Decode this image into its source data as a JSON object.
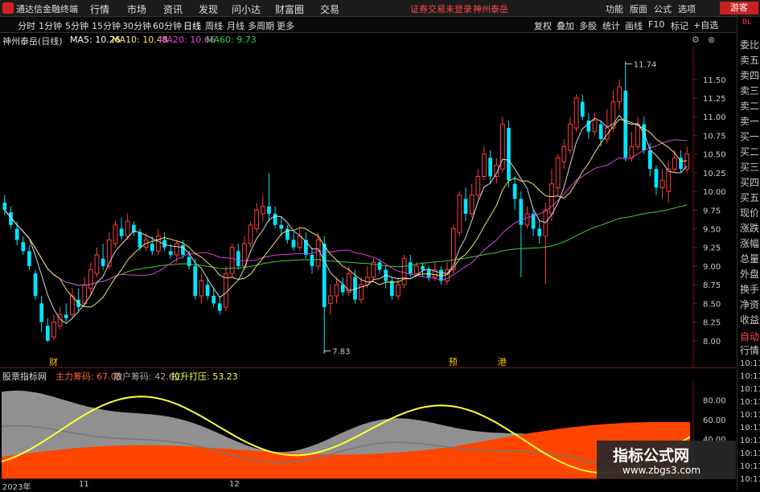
{
  "app": {
    "title": "通达信金融终端",
    "menu": [
      "行情",
      "市场",
      "资讯",
      "发现",
      "问小达",
      "财富圈",
      "交易"
    ],
    "status_text": "证券交易未登录",
    "stock_link": "神州泰岳",
    "right_menu": [
      "功能",
      "版面",
      "公式",
      "选项"
    ],
    "guest": "游客"
  },
  "toolbar": {
    "timeframes": [
      "分时",
      "1分钟",
      "5分钟",
      "15分钟",
      "30分钟",
      "60分钟",
      "日线",
      "周线",
      "月线",
      "多周期",
      "更多"
    ],
    "active": "日线",
    "right_tools": [
      "复权",
      "叠加",
      "多股",
      "统计",
      "画线",
      "F10",
      "标记"
    ],
    "auto_select": "+自选"
  },
  "stock_header": {
    "name": "神州泰岳(日线)",
    "ma5": "MA5: 10.26",
    "ma10": "MA10: 10.48",
    "ma20": "MA20: 10.66",
    "ma60": "MA60: 9.73",
    "colors": {
      "ma5": "#ffffff",
      "ma10": "#f5e56b",
      "ma20": "#e040e0",
      "ma60": "#40d040"
    }
  },
  "right_panel": {
    "top_tag": "BL",
    "labels": [
      "委比",
      "卖五",
      "卖四",
      "卖三",
      "卖二",
      "卖一",
      "买一",
      "买二",
      "买三",
      "买四",
      "买五",
      "现价",
      "涨跌",
      "涨幅",
      "总量",
      "外盘",
      "换手",
      "净资",
      "收益",
      "自动",
      "行情"
    ],
    "times": [
      "10:11",
      "10:11",
      "10:11",
      "10:11",
      "10:11",
      "10:11",
      "10:11",
      "10:11",
      "10:11",
      "10:11"
    ]
  },
  "indicator_header": {
    "name": "股票指标网",
    "main": "主力筹码: 67.08",
    "retail": "散户筹码: 42.60",
    "pull": "拉升打压: 53.23"
  },
  "x_axis_labels": [
    "2023年",
    "11",
    "12"
  ],
  "watermark": {
    "line1": "指标公式网",
    "line2": "www.zbgs3.com"
  },
  "chart_data": {
    "type": "candlestick",
    "y_ticks": [
      "11.50",
      "11.25",
      "11.00",
      "10.75",
      "10.50",
      "10.25",
      "10.00",
      "9.75",
      "9.50",
      "9.25",
      "9.00",
      "8.75",
      "8.50",
      "8.25",
      "8.00"
    ],
    "ylim": [
      7.75,
      11.95
    ],
    "high_label": "11.74",
    "low_label": "7.83",
    "event_markers": [
      "财",
      "预",
      "港"
    ],
    "up_color": "#ff4040",
    "down_color": "#00e5ff",
    "candles": [
      [
        9.85,
        9.75,
        9.95,
        9.68
      ],
      [
        9.72,
        9.55,
        9.8,
        9.5
      ],
      [
        9.5,
        9.35,
        9.6,
        9.28
      ],
      [
        9.32,
        9.2,
        9.4,
        9.15
      ],
      [
        9.2,
        9.0,
        9.28,
        8.95
      ],
      [
        8.9,
        8.6,
        8.95,
        8.55
      ],
      [
        8.5,
        8.25,
        8.6,
        8.12
      ],
      [
        8.2,
        8.0,
        8.3,
        7.98
      ],
      [
        8.05,
        8.25,
        8.35,
        8.0
      ],
      [
        8.2,
        8.35,
        8.45,
        8.15
      ],
      [
        8.35,
        8.3,
        8.5,
        8.25
      ],
      [
        8.35,
        8.6,
        8.7,
        8.3
      ],
      [
        8.55,
        8.45,
        8.7,
        8.4
      ],
      [
        8.5,
        8.75,
        8.85,
        8.45
      ],
      [
        8.7,
        8.95,
        9.05,
        8.6
      ],
      [
        8.9,
        9.15,
        9.25,
        8.85
      ],
      [
        9.1,
        9.0,
        9.3,
        8.95
      ],
      [
        9.0,
        9.35,
        9.45,
        8.95
      ],
      [
        9.3,
        9.55,
        9.6,
        9.25
      ],
      [
        9.5,
        9.4,
        9.65,
        9.35
      ],
      [
        9.4,
        9.6,
        9.7,
        9.35
      ],
      [
        9.55,
        9.45,
        9.6,
        9.4
      ],
      [
        9.45,
        9.25,
        9.5,
        9.2
      ],
      [
        9.25,
        9.35,
        9.45,
        9.2
      ],
      [
        9.3,
        9.2,
        9.4,
        9.15
      ],
      [
        9.2,
        9.4,
        9.5,
        9.15
      ],
      [
        9.35,
        9.25,
        9.45,
        9.2
      ],
      [
        9.2,
        9.15,
        9.3,
        9.1
      ],
      [
        9.15,
        9.3,
        9.35,
        9.05
      ],
      [
        9.28,
        9.15,
        9.35,
        9.1
      ],
      [
        9.12,
        9.0,
        9.2,
        8.95
      ],
      [
        9.0,
        8.6,
        9.1,
        8.55
      ],
      [
        8.6,
        8.8,
        8.9,
        8.5
      ],
      [
        8.75,
        8.6,
        8.85,
        8.55
      ],
      [
        8.6,
        8.5,
        8.7,
        8.45
      ],
      [
        8.5,
        8.4,
        8.6,
        8.35
      ],
      [
        8.45,
        8.9,
        9.0,
        8.4
      ],
      [
        8.9,
        9.25,
        9.3,
        8.85
      ],
      [
        9.2,
        9.0,
        9.3,
        8.95
      ],
      [
        9.0,
        9.3,
        9.4,
        8.95
      ],
      [
        9.3,
        9.55,
        9.6,
        9.25
      ],
      [
        9.5,
        9.75,
        9.85,
        9.45
      ],
      [
        9.7,
        9.8,
        9.95,
        9.6
      ],
      [
        9.8,
        9.7,
        10.25,
        9.6
      ],
      [
        9.7,
        9.55,
        9.8,
        9.5
      ],
      [
        9.55,
        9.5,
        9.65,
        9.4
      ],
      [
        9.5,
        9.35,
        9.55,
        9.3
      ],
      [
        9.35,
        9.25,
        9.45,
        9.2
      ],
      [
        9.25,
        9.4,
        9.5,
        9.2
      ],
      [
        9.35,
        9.15,
        9.45,
        9.1
      ],
      [
        9.15,
        9.0,
        9.25,
        8.9
      ],
      [
        9.0,
        9.35,
        9.45,
        8.95
      ],
      [
        9.3,
        8.45,
        9.4,
        7.83
      ],
      [
        8.5,
        8.6,
        8.75,
        8.35
      ],
      [
        8.6,
        8.75,
        8.85,
        8.5
      ],
      [
        8.75,
        8.65,
        8.85,
        8.6
      ],
      [
        8.65,
        8.9,
        9.0,
        8.6
      ],
      [
        8.85,
        8.55,
        8.95,
        8.5
      ],
      [
        8.55,
        8.75,
        8.85,
        8.5
      ],
      [
        8.75,
        8.85,
        9.0,
        8.7
      ],
      [
        8.85,
        9.05,
        9.1,
        8.8
      ],
      [
        9.05,
        8.95,
        9.1,
        8.9
      ],
      [
        8.95,
        8.8,
        9.0,
        8.7
      ],
      [
        8.8,
        8.6,
        8.85,
        8.55
      ],
      [
        8.6,
        8.75,
        8.85,
        8.55
      ],
      [
        8.75,
        9.1,
        9.15,
        8.7
      ],
      [
        9.05,
        8.9,
        9.15,
        8.85
      ],
      [
        8.9,
        9.0,
        9.05,
        8.85
      ],
      [
        9.0,
        8.95,
        9.05,
        8.85
      ],
      [
        8.95,
        8.85,
        9.0,
        8.8
      ],
      [
        8.85,
        8.95,
        9.05,
        8.8
      ],
      [
        8.95,
        8.8,
        9.0,
        8.75
      ],
      [
        8.8,
        8.95,
        9.05,
        8.75
      ],
      [
        8.95,
        9.5,
        9.55,
        8.9
      ],
      [
        9.45,
        9.95,
        10.0,
        9.4
      ],
      [
        9.9,
        9.7,
        10.05,
        9.6
      ],
      [
        9.7,
        9.95,
        10.1,
        9.65
      ],
      [
        9.95,
        10.2,
        10.3,
        9.9
      ],
      [
        10.2,
        10.5,
        10.6,
        10.15
      ],
      [
        10.45,
        10.2,
        10.55,
        10.1
      ],
      [
        10.2,
        10.35,
        10.45,
        10.1
      ],
      [
        10.3,
        10.9,
        11.0,
        10.25
      ],
      [
        10.85,
        10.15,
        10.95,
        10.05
      ],
      [
        10.1,
        9.9,
        10.2,
        9.75
      ],
      [
        9.9,
        9.55,
        10.0,
        8.85
      ],
      [
        9.55,
        9.7,
        9.8,
        9.5
      ],
      [
        9.7,
        9.5,
        9.75,
        9.4
      ],
      [
        9.5,
        9.4,
        9.6,
        9.3
      ],
      [
        9.4,
        9.75,
        9.85,
        8.75
      ],
      [
        9.7,
        10.1,
        10.3,
        9.6
      ],
      [
        10.05,
        10.45,
        10.5,
        9.95
      ],
      [
        10.4,
        10.6,
        10.7,
        10.3
      ],
      [
        10.55,
        10.9,
        11.0,
        10.5
      ],
      [
        10.85,
        11.25,
        11.3,
        10.8
      ],
      [
        11.2,
        11.0,
        11.3,
        10.95
      ],
      [
        10.95,
        10.8,
        11.05,
        10.7
      ],
      [
        10.8,
        10.95,
        11.05,
        10.75
      ],
      [
        10.9,
        10.7,
        10.95,
        10.6
      ],
      [
        10.7,
        10.85,
        11.1,
        10.65
      ],
      [
        10.85,
        11.2,
        11.35,
        10.8
      ],
      [
        11.2,
        11.4,
        11.5,
        11.1
      ],
      [
        11.35,
        10.45,
        11.74,
        10.4
      ],
      [
        10.45,
        10.6,
        10.8,
        10.4
      ],
      [
        10.6,
        10.9,
        11.0,
        10.55
      ],
      [
        10.9,
        10.55,
        11.0,
        10.5
      ],
      [
        10.55,
        10.3,
        10.65,
        10.2
      ],
      [
        10.3,
        10.05,
        10.35,
        9.95
      ],
      [
        10.05,
        10.15,
        10.3,
        9.9
      ],
      [
        10.0,
        10.3,
        10.4,
        9.85
      ],
      [
        10.3,
        10.45,
        10.55,
        10.25
      ],
      [
        10.45,
        10.3,
        10.55,
        10.25
      ],
      [
        10.3,
        10.5,
        10.6,
        10.25
      ]
    ],
    "indicator": {
      "ylim": [
        0,
        100
      ],
      "y_ticks": [
        "80.00",
        "60.00",
        "40.00"
      ],
      "series": [
        {
          "name": "主力筹码",
          "color": "#ff4500"
        },
        {
          "name": "散户筹码",
          "color": "#909090"
        },
        {
          "name": "拉升打压",
          "color": "#ffff33"
        }
      ]
    }
  }
}
